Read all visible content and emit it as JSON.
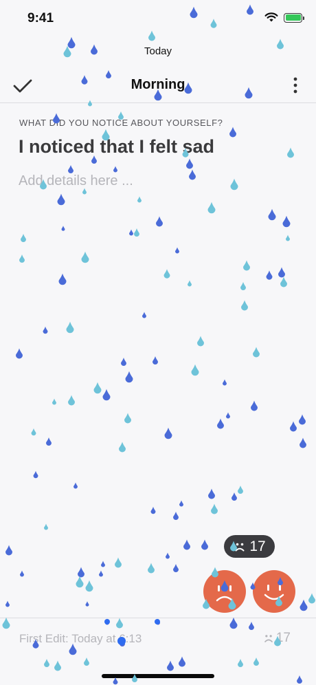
{
  "status_bar": {
    "time": "9:41",
    "battery_level": 1.0
  },
  "date_label": "Today",
  "header": {
    "title": "Morning"
  },
  "entry": {
    "question": "WHAT DID YOU NOTICE ABOUT YOURSELF?",
    "answer": "I noticed that I felt sad",
    "details_placeholder": "Add details here ...",
    "details_value": ""
  },
  "mood": {
    "count": "17"
  },
  "footer": {
    "first_edit": "First Edit: Today at 6:13",
    "mood_count": "17"
  },
  "colors": {
    "coral": "#e4694a",
    "drop_dark": "#4a6bd8",
    "drop_light": "#6ec3d9"
  }
}
